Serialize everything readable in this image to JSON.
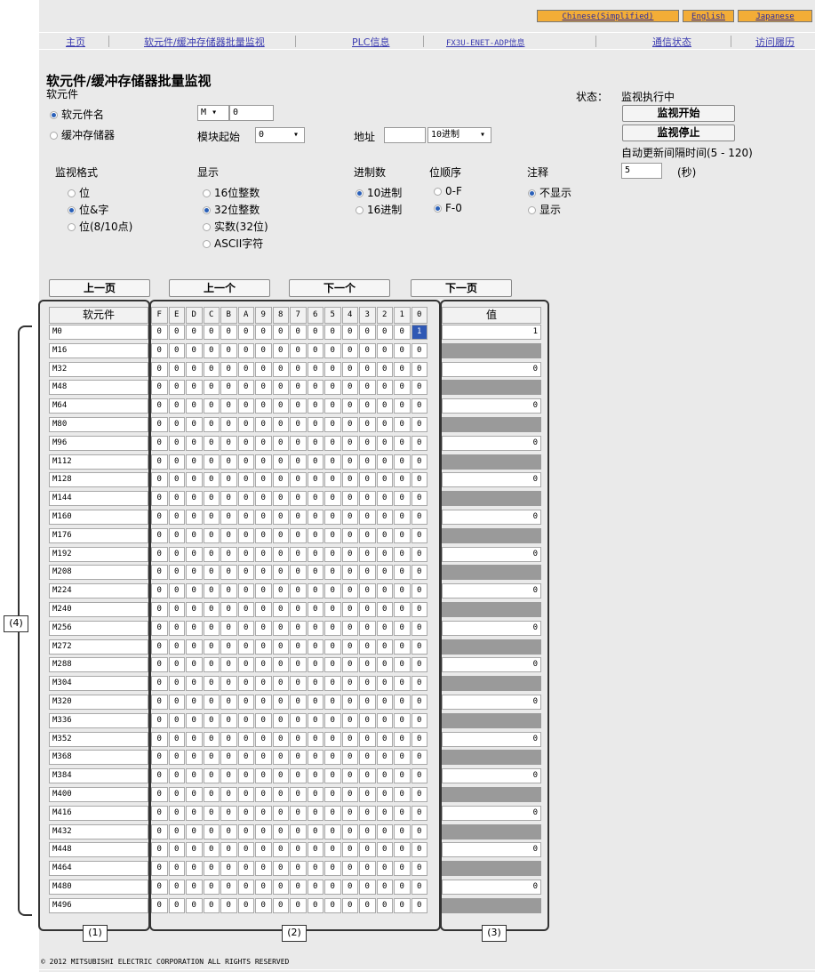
{
  "languages": [
    "Chinese(Simplified)",
    "English",
    "Japanese"
  ],
  "nav": [
    "主页",
    "软元件/缓冲存储器批量监视",
    "PLC信息",
    "FX3U-ENET-ADP信息",
    "通信状态",
    "访问履历"
  ],
  "page": {
    "title": "软元件/缓冲存储器批量监视",
    "target_label": "软元件",
    "status_label": "状态：",
    "status_value": "监视执行中",
    "start_button": "监视开始",
    "stop_button": "监视停止",
    "interval_label": "自动更新间隔时间(5 - 120)",
    "interval_value": "5",
    "interval_unit": "(秒)"
  },
  "target": {
    "device_radio": "软元件名",
    "buffer_radio": "缓冲存储器",
    "device_type": "M",
    "device_number": "0",
    "module_label": "模块起始",
    "module_value": "0",
    "address_label": "地址",
    "address_value": "",
    "address_radix": "10进制"
  },
  "options": {
    "format": {
      "label": "监视格式",
      "items": [
        {
          "text": "位",
          "on": false
        },
        {
          "text": "位&字",
          "on": true
        },
        {
          "text": "位(8/10点)",
          "on": false
        }
      ]
    },
    "display": {
      "label": "显示",
      "items": [
        {
          "text": "16位整数",
          "on": false
        },
        {
          "text": "32位整数",
          "on": true
        },
        {
          "text": "实数(32位)",
          "on": false
        },
        {
          "text": "ASCII字符",
          "on": false
        }
      ]
    },
    "radix": {
      "label": "进制数",
      "items": [
        {
          "text": "10进制",
          "on": true
        },
        {
          "text": "16进制",
          "on": false
        }
      ]
    },
    "bitorder": {
      "label": "位顺序",
      "items": [
        {
          "text": "0-F",
          "on": false
        },
        {
          "text": "F-0",
          "on": true
        }
      ]
    },
    "comment": {
      "label": "注释",
      "items": [
        {
          "text": "不显示",
          "on": true
        },
        {
          "text": "显示",
          "on": false
        }
      ]
    }
  },
  "paging": [
    "上一页",
    "上一个",
    "下一个",
    "下一页"
  ],
  "table": {
    "device_header": "软元件",
    "bit_headers": [
      "F",
      "E",
      "D",
      "C",
      "B",
      "A",
      "9",
      "8",
      "7",
      "6",
      "5",
      "4",
      "3",
      "2",
      "1",
      "0"
    ],
    "value_header": "值",
    "rows": [
      {
        "device": "M0",
        "bits": "0000000000000001",
        "value": "1"
      },
      {
        "device": "M16",
        "bits": "0000000000000000",
        "value": ""
      },
      {
        "device": "M32",
        "bits": "0000000000000000",
        "value": "0"
      },
      {
        "device": "M48",
        "bits": "0000000000000000",
        "value": ""
      },
      {
        "device": "M64",
        "bits": "0000000000000000",
        "value": "0"
      },
      {
        "device": "M80",
        "bits": "0000000000000000",
        "value": ""
      },
      {
        "device": "M96",
        "bits": "0000000000000000",
        "value": "0"
      },
      {
        "device": "M112",
        "bits": "0000000000000000",
        "value": ""
      },
      {
        "device": "M128",
        "bits": "0000000000000000",
        "value": "0"
      },
      {
        "device": "M144",
        "bits": "0000000000000000",
        "value": ""
      },
      {
        "device": "M160",
        "bits": "0000000000000000",
        "value": "0"
      },
      {
        "device": "M176",
        "bits": "0000000000000000",
        "value": ""
      },
      {
        "device": "M192",
        "bits": "0000000000000000",
        "value": "0"
      },
      {
        "device": "M208",
        "bits": "0000000000000000",
        "value": ""
      },
      {
        "device": "M224",
        "bits": "0000000000000000",
        "value": "0"
      },
      {
        "device": "M240",
        "bits": "0000000000000000",
        "value": ""
      },
      {
        "device": "M256",
        "bits": "0000000000000000",
        "value": "0"
      },
      {
        "device": "M272",
        "bits": "0000000000000000",
        "value": ""
      },
      {
        "device": "M288",
        "bits": "0000000000000000",
        "value": "0"
      },
      {
        "device": "M304",
        "bits": "0000000000000000",
        "value": ""
      },
      {
        "device": "M320",
        "bits": "0000000000000000",
        "value": "0"
      },
      {
        "device": "M336",
        "bits": "0000000000000000",
        "value": ""
      },
      {
        "device": "M352",
        "bits": "0000000000000000",
        "value": "0"
      },
      {
        "device": "M368",
        "bits": "0000000000000000",
        "value": ""
      },
      {
        "device": "M384",
        "bits": "0000000000000000",
        "value": "0"
      },
      {
        "device": "M400",
        "bits": "0000000000000000",
        "value": ""
      },
      {
        "device": "M416",
        "bits": "0000000000000000",
        "value": "0"
      },
      {
        "device": "M432",
        "bits": "0000000000000000",
        "value": ""
      },
      {
        "device": "M448",
        "bits": "0000000000000000",
        "value": "0"
      },
      {
        "device": "M464",
        "bits": "0000000000000000",
        "value": ""
      },
      {
        "device": "M480",
        "bits": "0000000000000000",
        "value": "0"
      },
      {
        "device": "M496",
        "bits": "0000000000000000",
        "value": ""
      }
    ]
  },
  "callouts": [
    "(1)",
    "(2)",
    "(3)",
    "(4)"
  ],
  "footer": "© 2012 MITSUBISHI ELECTRIC CORPORATION ALL RIGHTS RESERVED"
}
